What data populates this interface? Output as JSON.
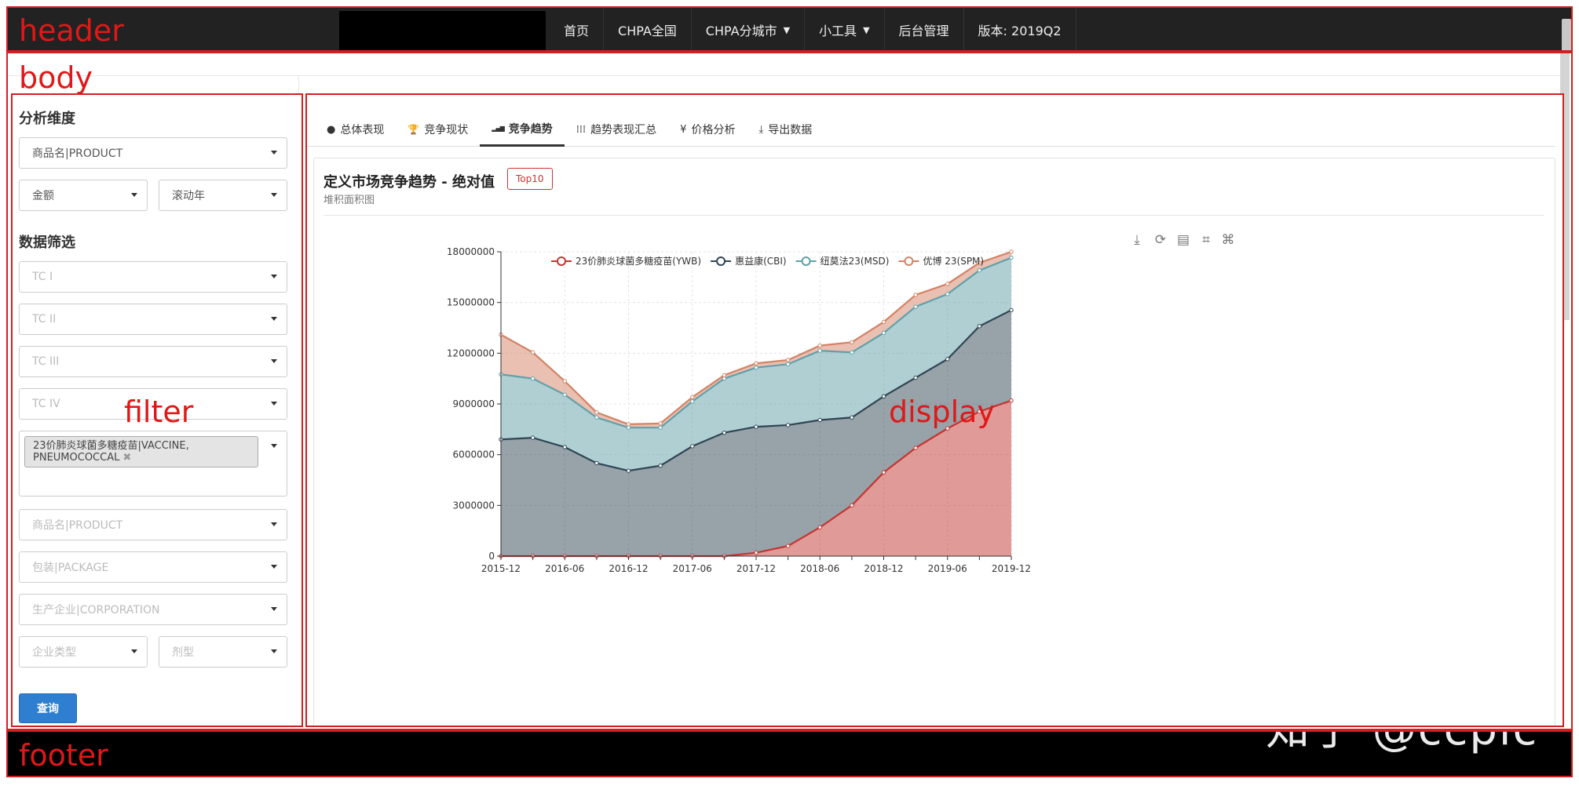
{
  "header": {
    "nav": [
      {
        "label": "首页",
        "dropdown": false
      },
      {
        "label": "CHPA全国",
        "dropdown": false
      },
      {
        "label": "CHPA分城市",
        "dropdown": true
      },
      {
        "label": "小工具",
        "dropdown": true
      },
      {
        "label": "后台管理",
        "dropdown": false
      },
      {
        "label": "版本: 2019Q2",
        "dropdown": false
      }
    ]
  },
  "annotations": {
    "header": "header",
    "body": "body",
    "filter": "filter",
    "display": "display",
    "footer": "footer"
  },
  "sidebar": {
    "analysis_title": "分析维度",
    "dimension": "商品名|PRODUCT",
    "metric": "金额",
    "period": "滚动年",
    "filter_title": "数据筛选",
    "tc1": "TC I",
    "tc2": "TC II",
    "tc3": "TC III",
    "tc4": "TC IV",
    "molecule_tag": "23价肺炎球菌多糖疫苗|VACCINE, PNEUMOCOCCAL",
    "product": "商品名|PRODUCT",
    "package": "包装|PACKAGE",
    "corporation": "生产企业|CORPORATION",
    "corp_type": "企业类型",
    "dosage": "剂型",
    "query_button": "查询"
  },
  "display": {
    "tabs": [
      {
        "label": "总体表现",
        "icon": "circle-icon"
      },
      {
        "label": "竞争现状",
        "icon": "trophy-icon"
      },
      {
        "label": "竞争趋势",
        "icon": "signal-icon",
        "active": true
      },
      {
        "label": "趋势表现汇总",
        "icon": "th-icon"
      },
      {
        "label": "价格分析",
        "icon": "yen-icon"
      },
      {
        "label": "导出数据",
        "icon": "download-icon"
      }
    ],
    "panel_title": "定义市场竞争趋势 - 绝对值",
    "badge": "Top10",
    "panel_subtitle": "堆积面积图",
    "toolbox": [
      "download-icon",
      "refresh-icon",
      "dataview-icon",
      "zoom-icon",
      "zoom-reset-icon"
    ]
  },
  "watermark": "知乎 @ccpic",
  "chart_data": {
    "type": "area",
    "stacked": true,
    "x": [
      "2015-12",
      "2016-03",
      "2016-06",
      "2016-09",
      "2016-12",
      "2017-03",
      "2017-06",
      "2017-09",
      "2017-12",
      "2018-03",
      "2018-06",
      "2018-09",
      "2018-12",
      "2019-03",
      "2019-06",
      "2019-09",
      "2019-12"
    ],
    "x_tick_labels": [
      "2015-12",
      "2016-06",
      "2016-12",
      "2017-06",
      "2017-12",
      "2018-06",
      "2018-12",
      "2019-06",
      "2019-12"
    ],
    "ylim": [
      0,
      18000000
    ],
    "y_ticks": [
      0,
      3000000,
      6000000,
      9000000,
      12000000,
      15000000,
      18000000
    ],
    "legend_position": "top-left",
    "grid": true,
    "series": [
      {
        "name": "23价肺炎球菌多糖疫苗(YWB)",
        "color": "#c23531",
        "values": [
          0,
          0,
          0,
          0,
          0,
          0,
          0,
          0,
          200000,
          600000,
          1700000,
          3000000,
          4950000,
          6400000,
          7550000,
          8550000,
          9200000
        ]
      },
      {
        "name": "惠益康(CBI)",
        "color": "#2f4554",
        "values": [
          6900000,
          7000000,
          6450000,
          5500000,
          5050000,
          5350000,
          6500000,
          7300000,
          7450000,
          7150000,
          6350000,
          5200000,
          4500000,
          4150000,
          4100000,
          5050000,
          5350000
        ]
      },
      {
        "name": "纽莫法23(MSD)",
        "color": "#61a0a8",
        "values": [
          3850000,
          3500000,
          3100000,
          2700000,
          2550000,
          2250000,
          2650000,
          3200000,
          3500000,
          3600000,
          4100000,
          3850000,
          3750000,
          4200000,
          3850000,
          3300000,
          3100000
        ]
      },
      {
        "name": "优博 23(SPM)",
        "color": "#d48265",
        "values": [
          2350000,
          1550000,
          800000,
          300000,
          200000,
          250000,
          250000,
          200000,
          250000,
          250000,
          300000,
          600000,
          650000,
          700000,
          600000,
          450000,
          350000
        ]
      }
    ]
  }
}
